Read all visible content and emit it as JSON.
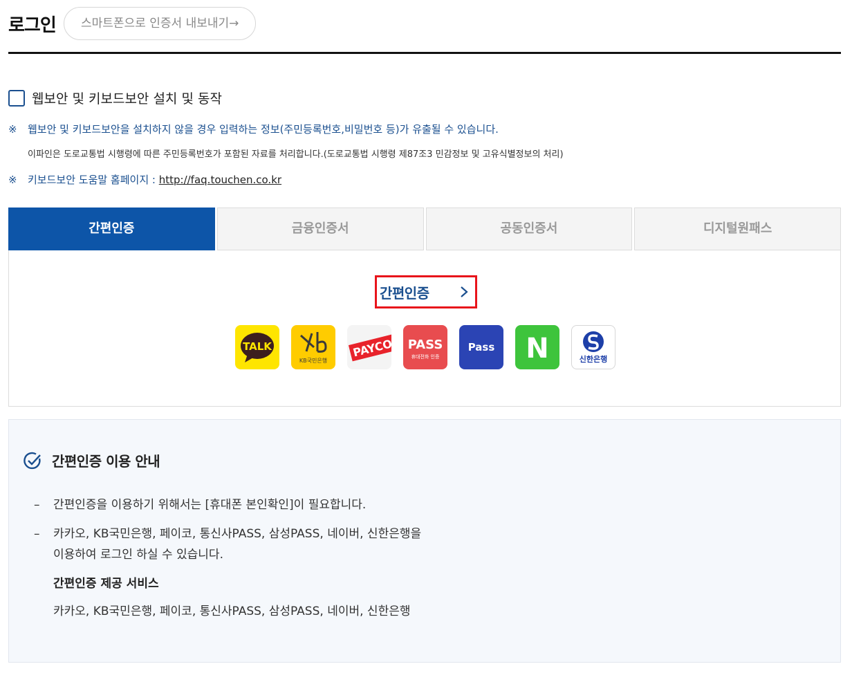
{
  "header": {
    "title": "로그인",
    "export_button": "스마트폰으로 인증서 내보내기→"
  },
  "security": {
    "checkbox_label": "웹보안 및 키보드보안 설치 및 동작",
    "checked": false
  },
  "notices": {
    "mark": "※",
    "warning": "웹보안 및 키보드보안을 설치하지 않을 경우 입력하는 정보(주민등록번호,비밀번호 등)가 유출될 수 있습니다.",
    "legal": "이파인은 도로교통법 시행령에 따른 주민등록번호가 포함된 자료를 처리합니다.(도로교통법 시행령 제87조3 민감정보 및 고유식별정보의 처리)",
    "help_prefix": "키보드보안 도움말 홈페이지 : ",
    "help_link": "http://faq.touchen.co.kr"
  },
  "tabs": [
    {
      "label": "간편인증",
      "active": true
    },
    {
      "label": "금융인증서",
      "active": false
    },
    {
      "label": "공동인증서",
      "active": false
    },
    {
      "label": "디지털원패스",
      "active": false
    }
  ],
  "panel": {
    "link_label": "간편인증",
    "providers": [
      {
        "id": "kakao",
        "text": "TALK",
        "bg": "#fee500",
        "fg": "#3c1e1e"
      },
      {
        "id": "kb",
        "text": "KB국민은행",
        "bg": "#ffcc00",
        "fg": "#3a3a3a"
      },
      {
        "id": "payco",
        "text": "PAYCO",
        "bg": "#f4f4f4",
        "fg": "#ffffff"
      },
      {
        "id": "pass-telecom",
        "text": "PASS",
        "subtext": "휴대전화 인증",
        "bg": "#e84c4f",
        "fg": "#ffffff"
      },
      {
        "id": "samsung-pass",
        "text": "Pass",
        "bg": "#2b44b4",
        "fg": "#ffffff"
      },
      {
        "id": "naver",
        "text": "N",
        "bg": "#3ec43c",
        "fg": "#ffffff"
      },
      {
        "id": "shinhan",
        "text": "신한은행",
        "bg": "#ffffff",
        "fg": "#1d3fa8"
      }
    ]
  },
  "guide": {
    "title": "간편인증 이용 안내",
    "dash": "–",
    "item1": "간편인증을 이용하기 위해서는 [휴대폰 본인확인]이 필요합니다.",
    "item2_line1": "카카오, KB국민은행, 페이코, 통신사PASS, 삼성PASS, 네이버, 신한은행을",
    "item2_line2": "이용하여 로그인 하실 수 있습니다.",
    "sub_title": "간편인증 제공 서비스",
    "sub_text": "카카오, KB국민은행, 페이코, 통신사PASS, 삼성PASS, 네이버, 신한은행"
  },
  "colors": {
    "accent": "#0d55a8",
    "highlight_border": "#e8141b",
    "notice_text": "#1a4f8f"
  }
}
